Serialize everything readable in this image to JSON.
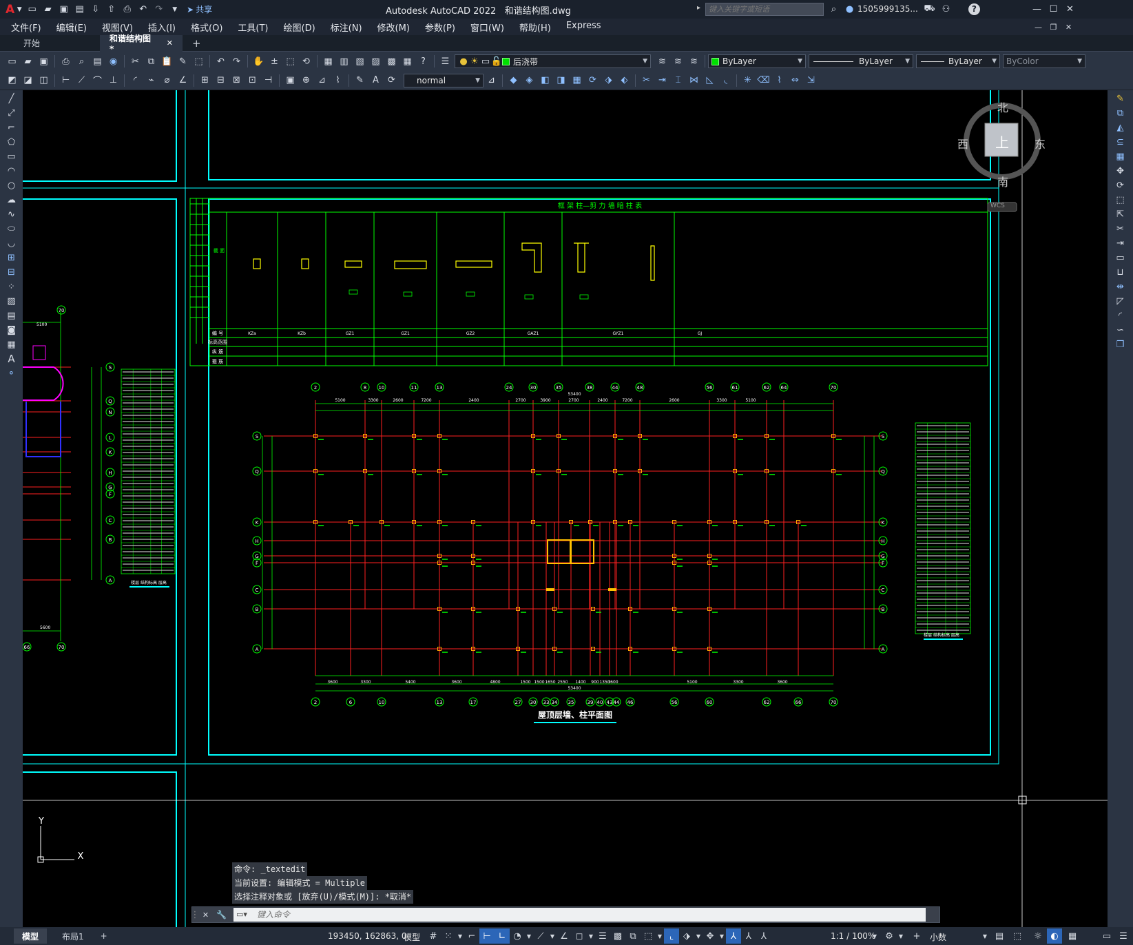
{
  "app": {
    "logo": "A",
    "title": "Autodesk AutoCAD 2022",
    "file": "和谐结构图.dwg",
    "share": "共享",
    "search_placeholder": "键入关键字或短语",
    "user": "1505999135...",
    "help": "?"
  },
  "menu": [
    "文件(F)",
    "编辑(E)",
    "视图(V)",
    "插入(I)",
    "格式(O)",
    "工具(T)",
    "绘图(D)",
    "标注(N)",
    "修改(M)",
    "参数(P)",
    "窗口(W)",
    "帮助(H)",
    "Express"
  ],
  "tabs": {
    "start": "开始",
    "doc": "和谐结构图*",
    "close": "✕",
    "add": "+"
  },
  "toolbar": {
    "layer": "后浇带",
    "color": "ByLayer",
    "linetype": "ByLayer",
    "lineweight": "ByLayer",
    "plotstyle": "ByColor",
    "textstyle": "normal"
  },
  "viewcube": {
    "n": "北",
    "s": "南",
    "e": "东",
    "w": "西",
    "top": "上",
    "wcs": "WCS"
  },
  "drawing": {
    "table_title": "框 架 柱—剪 力 墙 暗 柱 表",
    "plan_title": "屋顶层墙、柱平面图",
    "table_rows": [
      "编 号",
      "标高范围",
      "纵 筋",
      "箍 筋"
    ],
    "table_header": "截 面",
    "codes": [
      "KZa",
      "KZb",
      "GZ1",
      "GZ1",
      "GZ2",
      "GAZ1",
      "GYZ1",
      "GJ"
    ],
    "top_axes": [
      "2",
      "8",
      "10",
      "11",
      "13",
      "24",
      "30",
      "35",
      "38",
      "44",
      "48",
      "56",
      "61",
      "62",
      "64",
      "70"
    ],
    "bottom_axes": [
      "2",
      "6",
      "10",
      "13",
      "17",
      "27",
      "30",
      "33",
      "34",
      "35",
      "39",
      "40",
      "43",
      "44",
      "46",
      "56",
      "60",
      "62",
      "66",
      "70"
    ],
    "row_axes": [
      "S",
      "Q",
      "K",
      "H",
      "G",
      "F",
      "C",
      "B",
      "A"
    ],
    "top_dims": [
      "5100",
      "3300",
      "2600",
      "7200",
      "2400",
      "2700",
      "3900",
      "2700",
      "2400",
      "7200",
      "2600",
      "3300",
      "5100"
    ],
    "total_dim": "53400",
    "bottom_dims": [
      "3600",
      "3300",
      "5400",
      "3600",
      "4800",
      "1500",
      "1500",
      "1650",
      "2550",
      "1400",
      "900",
      "1350",
      "3600",
      "5100",
      "3300",
      "3600"
    ],
    "left_axes": [
      "S",
      "Q",
      "N",
      "L",
      "K",
      "H",
      "G",
      "F",
      "C",
      "B",
      "A"
    ],
    "left_circle_top": "70",
    "left_circle_bottom": [
      "66",
      "70"
    ],
    "left_dim": "5100",
    "left_dim_bottom": "5600",
    "left_table_caption": "楼层 结构标高 层高",
    "right_table_caption": "楼层 结构标高 层高"
  },
  "ucs": {
    "x": "X",
    "y": "Y"
  },
  "command": {
    "history": [
      "命令: _textedit",
      "当前设置: 编辑模式 = Multiple",
      "选择注释对象或 [放弃(U)/模式(M)]: *取消*"
    ],
    "placeholder": "键入命令"
  },
  "status": {
    "model_tab": "模型",
    "layout_tab": "布局1",
    "add": "+",
    "coords": "193450, 162863, 0",
    "space": "模型",
    "scale": "1:1 / 100%",
    "units": "小数"
  }
}
